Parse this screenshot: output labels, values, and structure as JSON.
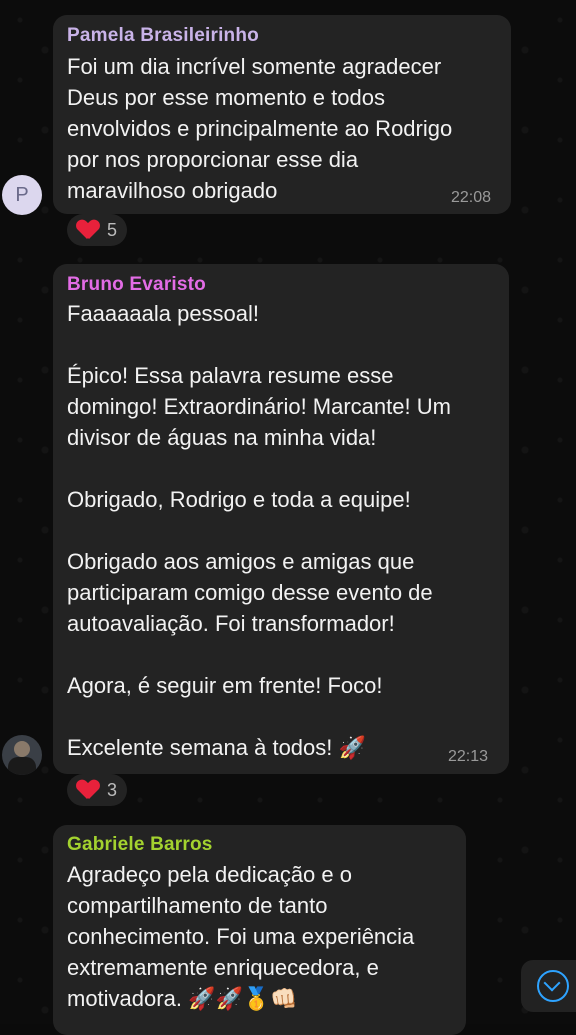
{
  "messages": [
    {
      "sender": "Pamela Brasileirinho",
      "sender_color": "#c9b3e8",
      "avatar_initial": "P",
      "text": "Foi um dia incrível somente agradecer\nDeus por esse momento e todos\nenvolvidos e principalmente ao Rodrigo\npor nos proporcionar esse dia\nmaravilhoso obrigado",
      "time": "22:08",
      "reaction": {
        "emoji": "❤️",
        "count": "5"
      }
    },
    {
      "sender": "Bruno Evaristo",
      "sender_color": "#e36ce6",
      "text": "Faaaaaala pessoal!\n\nÉpico! Essa palavra resume esse\ndomingo! Extraordinário! Marcante! Um\ndivisor de águas na minha vida!\n\nObrigado, Rodrigo e toda a equipe!\n\nObrigado aos amigos e amigas que\nparticiparam comigo desse evento de\nautoavaliação. Foi transformador!\n\nAgora, é seguir em frente! Foco!\n\nExcelente semana à todos! 🚀",
      "time": "22:13",
      "reaction": {
        "emoji": "❤️",
        "count": "3"
      }
    },
    {
      "sender": "Gabriele Barros",
      "sender_color": "#a3d22f",
      "text": "Agradeço pela dedicação e o\ncompartilhamento de tanto\nconhecimento. Foi uma experiência\nextremamente enriquecedora, e\nmotivadora. 🚀🚀🥇👊🏻"
    }
  ],
  "icons": {
    "scroll_down": "chevron-down-icon",
    "avatar_photo": "avatar-photo"
  }
}
